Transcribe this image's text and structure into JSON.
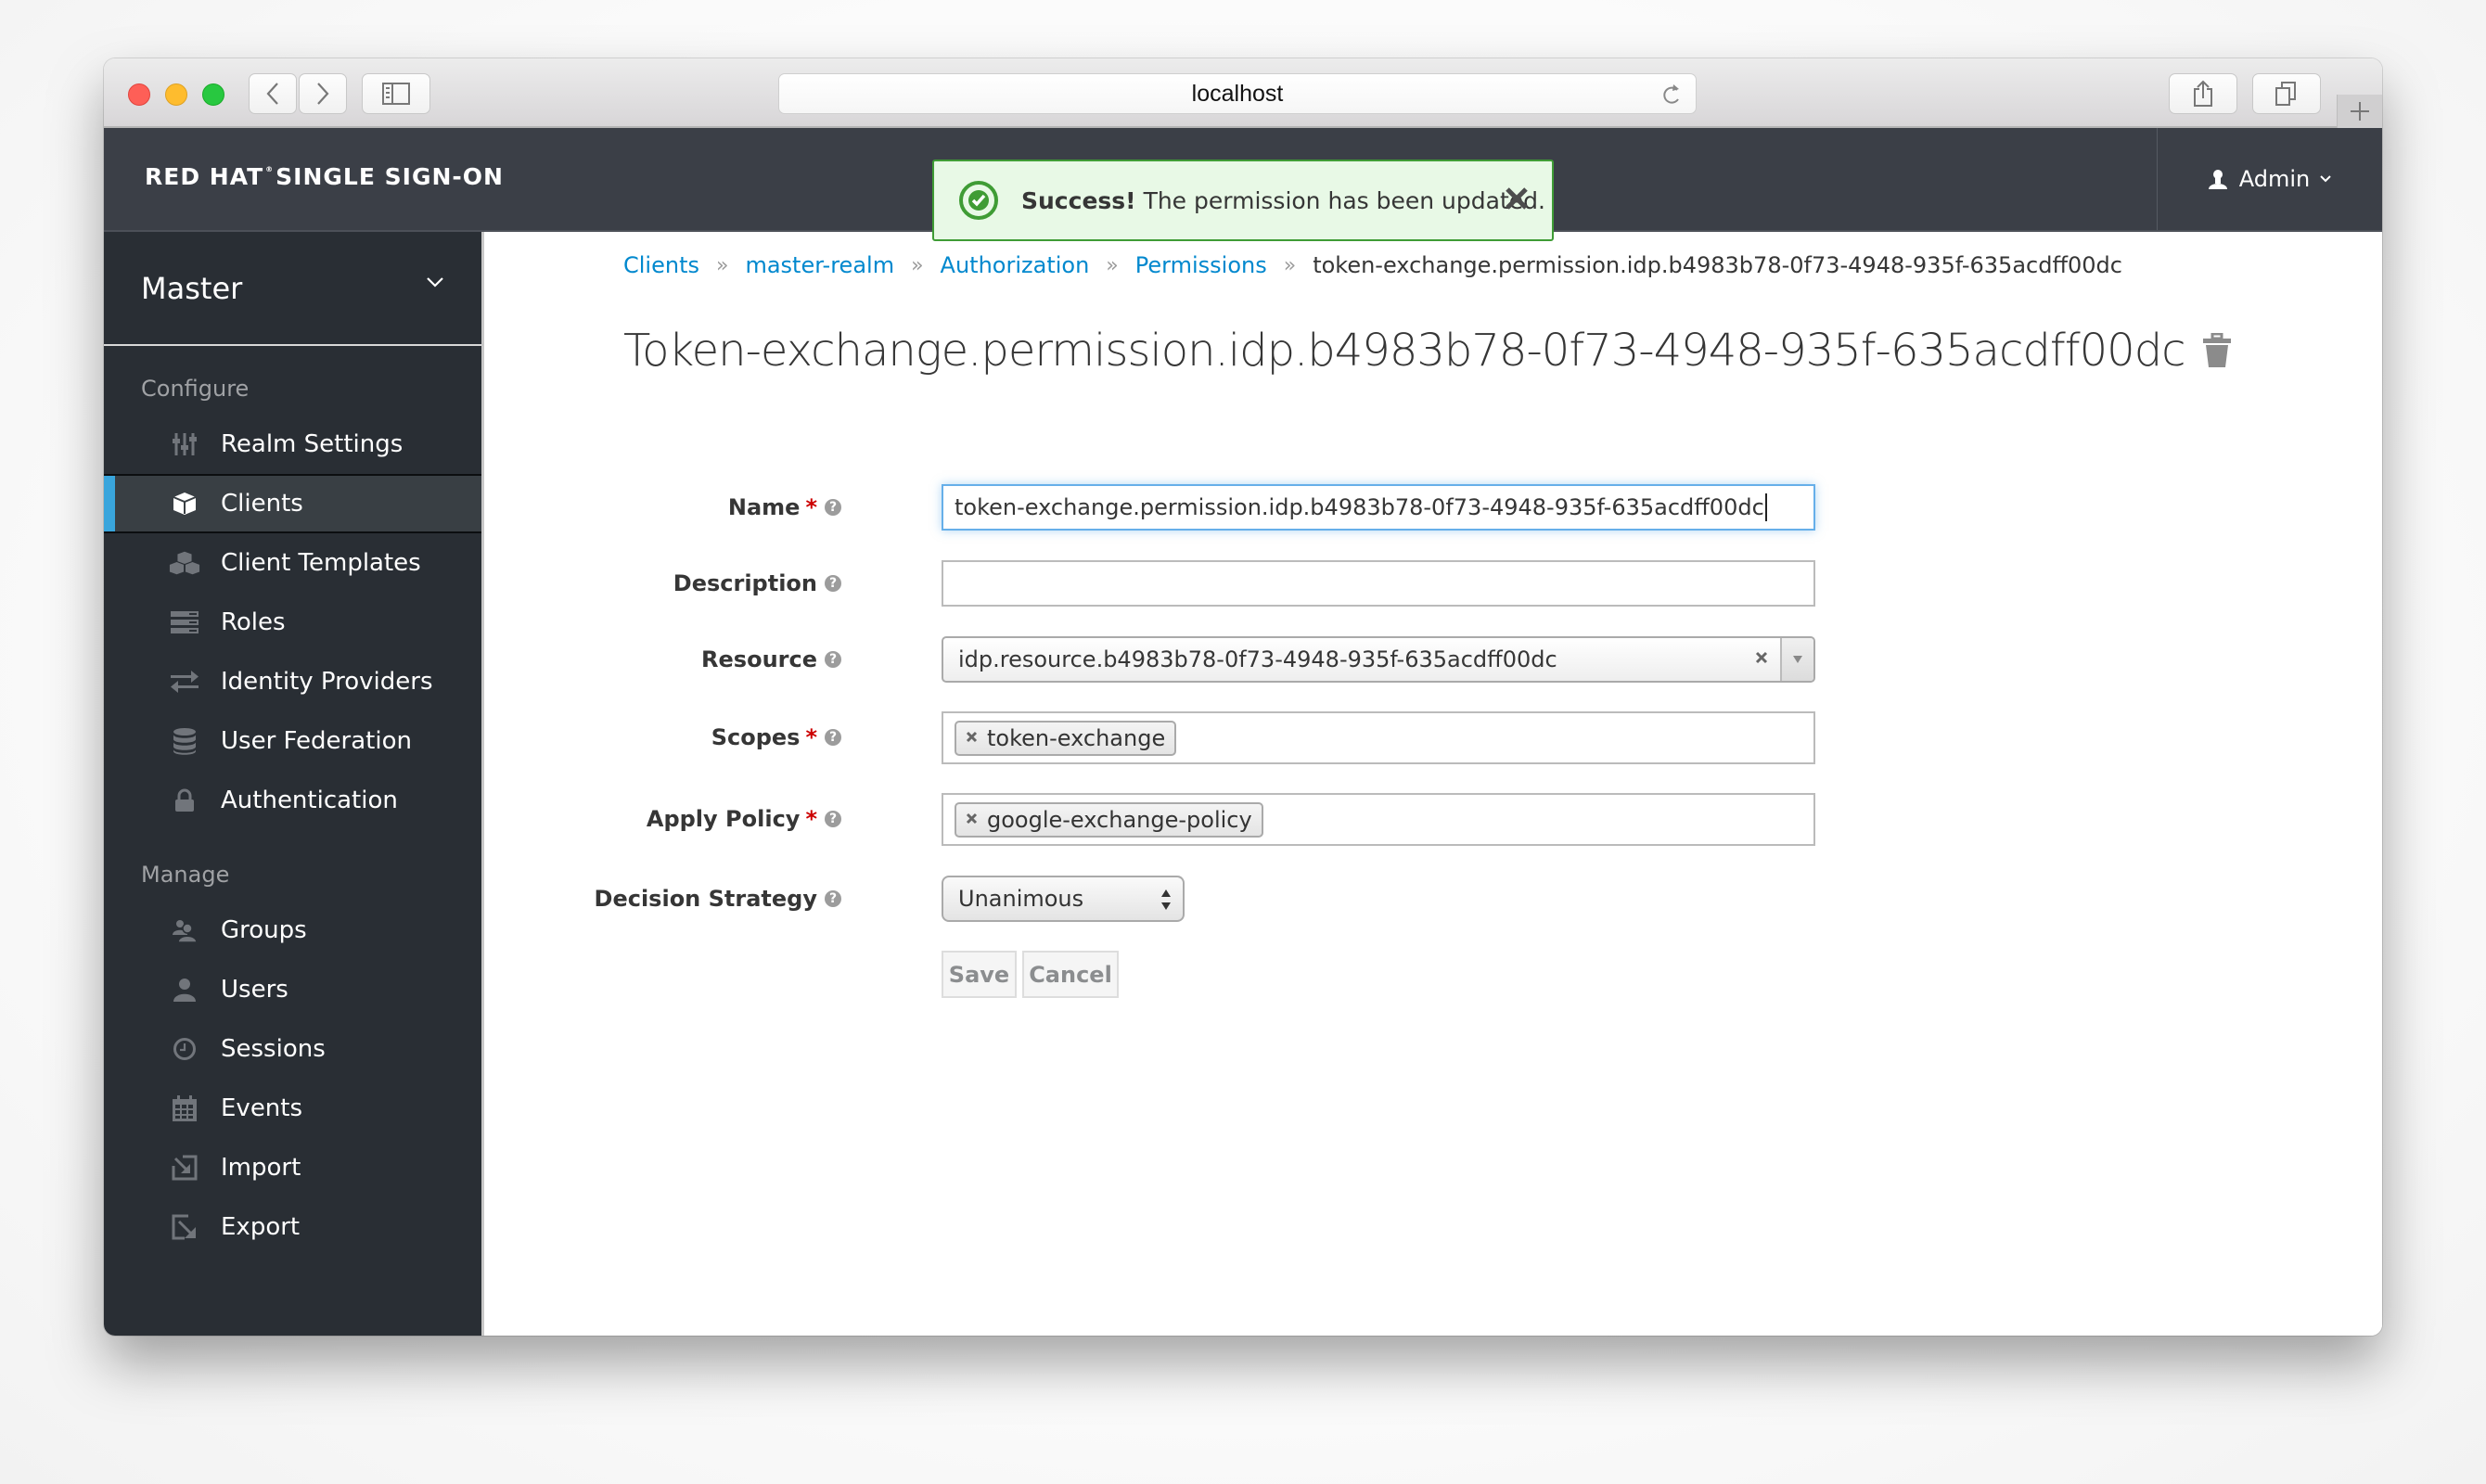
{
  "browser": {
    "url": "localhost"
  },
  "header": {
    "brand_main": "RED HAT",
    "brand_reg": "®",
    "brand_rest": "SINGLE SIGN-ON",
    "user": "Admin"
  },
  "toast": {
    "title": "Success!",
    "message": "The permission has been updated.",
    "status_color": "#3f9c35"
  },
  "sidebar": {
    "realm": "Master",
    "configure_label": "Configure",
    "configure_items": [
      {
        "label": "Realm Settings",
        "icon": "sliders-icon"
      },
      {
        "label": "Clients",
        "icon": "cube-icon",
        "active": true
      },
      {
        "label": "Client Templates",
        "icon": "cubes-icon"
      },
      {
        "label": "Roles",
        "icon": "server-icon"
      },
      {
        "label": "Identity Providers",
        "icon": "exchange-icon"
      },
      {
        "label": "User Federation",
        "icon": "database-icon"
      },
      {
        "label": "Authentication",
        "icon": "lock-icon"
      }
    ],
    "manage_label": "Manage",
    "manage_items": [
      {
        "label": "Groups",
        "icon": "users-icon"
      },
      {
        "label": "Users",
        "icon": "user-icon"
      },
      {
        "label": "Sessions",
        "icon": "clock-icon"
      },
      {
        "label": "Events",
        "icon": "calendar-icon"
      },
      {
        "label": "Import",
        "icon": "import-icon"
      },
      {
        "label": "Export",
        "icon": "export-icon"
      }
    ],
    "accent_color": "#39a5dc"
  },
  "breadcrumb": {
    "items": [
      "Clients",
      "master-realm",
      "Authorization",
      "Permissions"
    ],
    "separator": "»",
    "current": "token-exchange.permission.idp.b4983b78-0f73-4948-935f-635acdff00dc"
  },
  "page": {
    "title": "Token-exchange.permission.idp.b4983b78-0f73-4948-935f-635acdff00dc"
  },
  "form": {
    "name": {
      "label": "Name",
      "required": "*",
      "value": "token-exchange.permission.idp.b4983b78-0f73-4948-935f-635acdff00dc"
    },
    "description": {
      "label": "Description",
      "value": ""
    },
    "resource": {
      "label": "Resource",
      "value": "idp.resource.b4983b78-0f73-4948-935f-635acdff00dc"
    },
    "scopes": {
      "label": "Scopes",
      "required": "*",
      "tags": [
        "token-exchange"
      ]
    },
    "apply_policy": {
      "label": "Apply Policy",
      "required": "*",
      "tags": [
        "google-exchange-policy"
      ]
    },
    "decision_strategy": {
      "label": "Decision Strategy",
      "value": "Unanimous"
    },
    "help_glyph": "?",
    "save_label": "Save",
    "cancel_label": "Cancel"
  }
}
